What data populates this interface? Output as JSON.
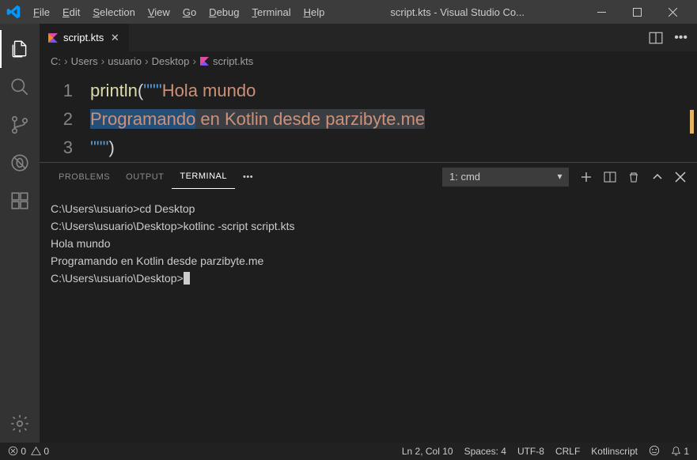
{
  "titlebar": {
    "menus": {
      "file": "File",
      "edit": "Edit",
      "selection": "Selection",
      "view": "View",
      "go": "Go",
      "debug": "Debug",
      "terminal": "Terminal",
      "help": "Help"
    },
    "title": "script.kts - Visual Studio Co..."
  },
  "tab": {
    "filename": "script.kts"
  },
  "breadcrumb": {
    "parts": [
      "C:",
      "Users",
      "usuario",
      "Desktop",
      "script.kts"
    ]
  },
  "code": {
    "line1": {
      "fn": "println",
      "open": "(",
      "triple": "\"\"\"",
      "rest": "Hola mundo"
    },
    "line2": {
      "word1": "Programando",
      "rest": " en Kotlin desde parzibyte.me"
    },
    "line3": {
      "triple": "\"\"\"",
      "close": ")"
    },
    "gutter": [
      "1",
      "2",
      "3"
    ]
  },
  "panel": {
    "tabs": {
      "problems": "PROBLEMS",
      "output": "OUTPUT",
      "terminal": "TERMINAL"
    },
    "selector": "1: cmd"
  },
  "terminal": {
    "l1": "C:\\Users\\usuario>cd Desktop",
    "l2": "",
    "l3": "C:\\Users\\usuario\\Desktop>kotlinc -script script.kts",
    "l4": "Hola mundo",
    "l5": "Programando en Kotlin desde parzibyte.me",
    "l6": "",
    "l7": "C:\\Users\\usuario\\Desktop>"
  },
  "statusbar": {
    "errors": "0",
    "warnings": "0",
    "pos": "Ln 2, Col 10",
    "spaces": "Spaces: 4",
    "encoding": "UTF-8",
    "eol": "CRLF",
    "lang": "Kotlinscript",
    "bell": "1"
  }
}
